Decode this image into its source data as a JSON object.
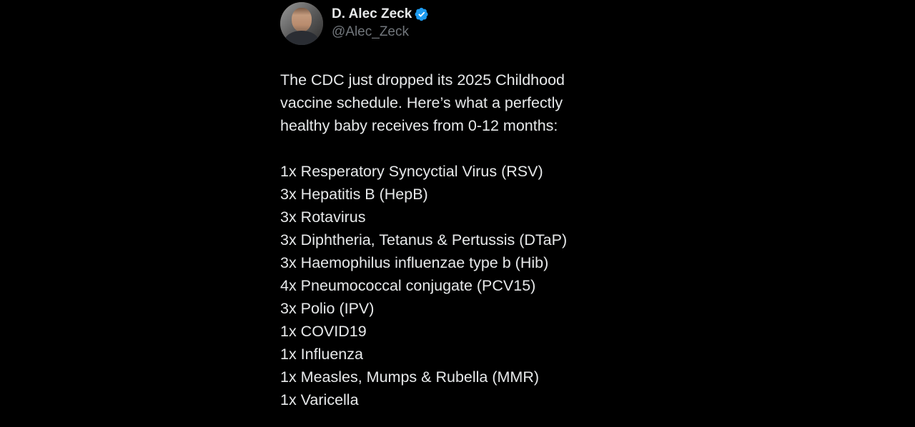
{
  "author": {
    "display_name": "D. Alec Zeck",
    "handle": "@Alec_Zeck",
    "avatar_icon": "user-avatar",
    "verified_icon": "verified-badge-icon",
    "verified_color": "#1d9bf0"
  },
  "tweet": {
    "intro_lines": [
      "The CDC just dropped its 2025 Childhood",
      "vaccine schedule. Here’s what a perfectly",
      "healthy baby receives from 0-12 months:"
    ],
    "schedule": [
      "1x Resperatory Syncyctial Virus (RSV)",
      "3x Hepatitis B (HepB)",
      "3x Rotavirus",
      "3x Diphtheria, Tetanus & Pertussis (DTaP)",
      "3x Haemophilus influenzae type b (Hib)",
      "4x Pneumococcal conjugate (PCV15)",
      "3x Polio (IPV)",
      "1x COVID19",
      "1x Influenza",
      "1x Measles, Mumps & Rubella (MMR)",
      "1x Varicella"
    ]
  },
  "colors": {
    "background": "#000000",
    "text_primary": "#e7e9ea",
    "text_secondary": "#71767b"
  }
}
